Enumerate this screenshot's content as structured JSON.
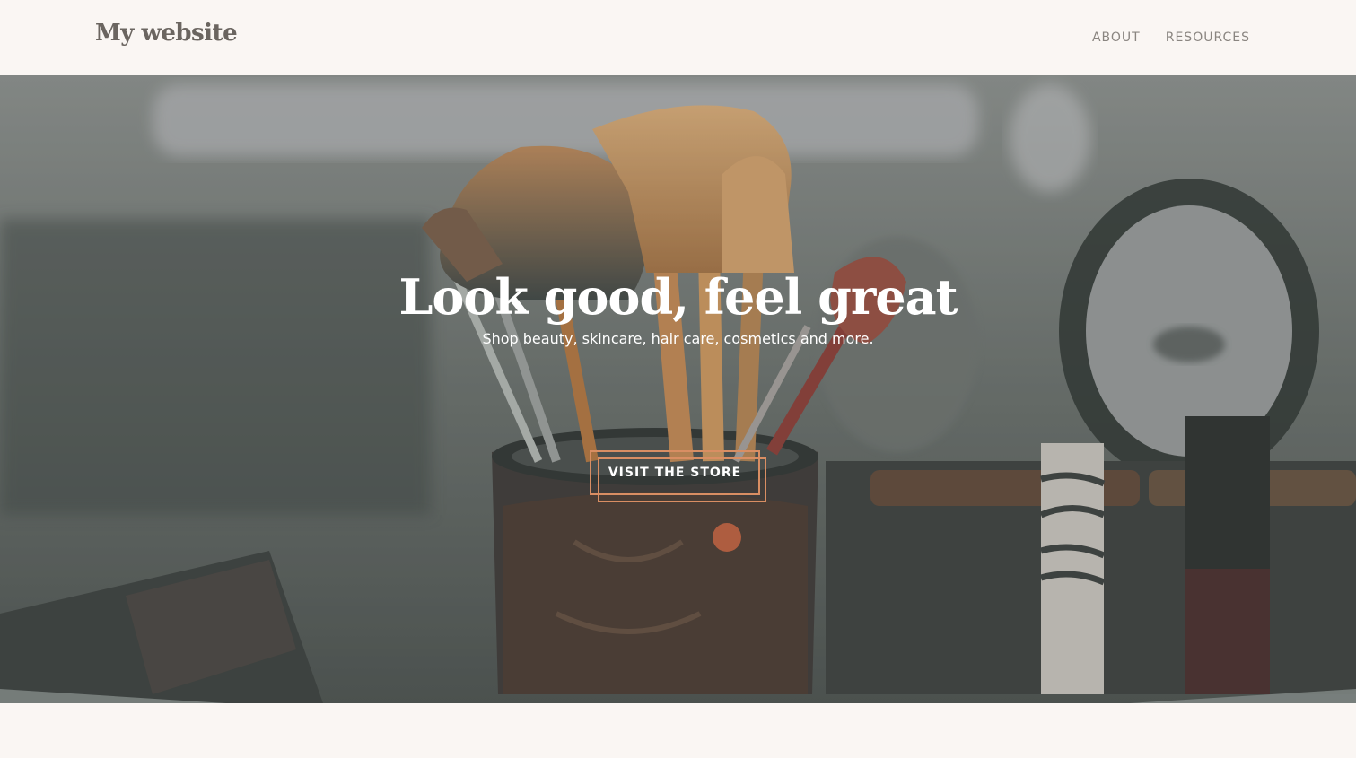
{
  "site": {
    "title": "My website"
  },
  "nav": {
    "items": [
      {
        "label": "ABOUT"
      },
      {
        "label": "RESOURCES"
      }
    ]
  },
  "hero": {
    "title": "Look good, feel great",
    "subtitle": "Shop beauty, skincare, hair care, cosmetics and more.",
    "cta_label": "VISIT THE STORE"
  },
  "colors": {
    "page_bg": "#faf6f3",
    "logo": "#6b6560",
    "nav_text": "#8a8580",
    "accent": "#d98e63",
    "hero_overlay": "#5a605d",
    "wedge_overlay": "#7f8684"
  },
  "icons": {}
}
